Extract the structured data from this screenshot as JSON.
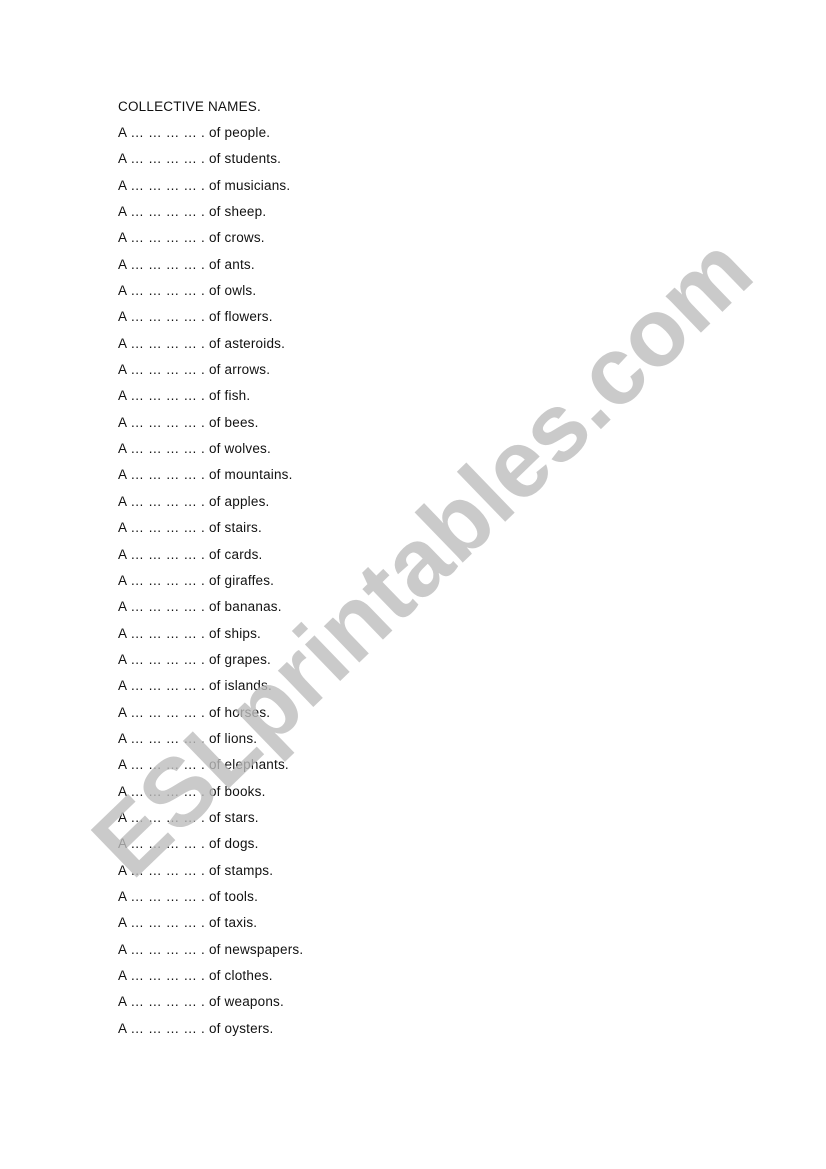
{
  "document": {
    "title": "COLLECTIVE NAMES.",
    "article": "A",
    "blank": "… … … … .",
    "items": [
      "of people.",
      "of students.",
      "of musicians.",
      "of sheep.",
      "of crows.",
      "of ants.",
      "of owls.",
      "of flowers.",
      "of asteroids.",
      "of arrows.",
      "of fish.",
      "of bees.",
      "of wolves.",
      "of mountains.",
      "of apples.",
      "of stairs.",
      "of cards.",
      "of giraffes.",
      "of bananas.",
      "of ships.",
      "of grapes.",
      "of islands.",
      "of horses.",
      "of lions.",
      "of elephants.",
      "of books.",
      "of stars.",
      "of dogs.",
      "of stamps.",
      "of tools.",
      "of taxis.",
      "of newspapers.",
      "of clothes.",
      "of weapons.",
      "of oysters."
    ]
  },
  "watermark": {
    "text": "ESLprintables.com",
    "color": "#bdbdbd"
  }
}
